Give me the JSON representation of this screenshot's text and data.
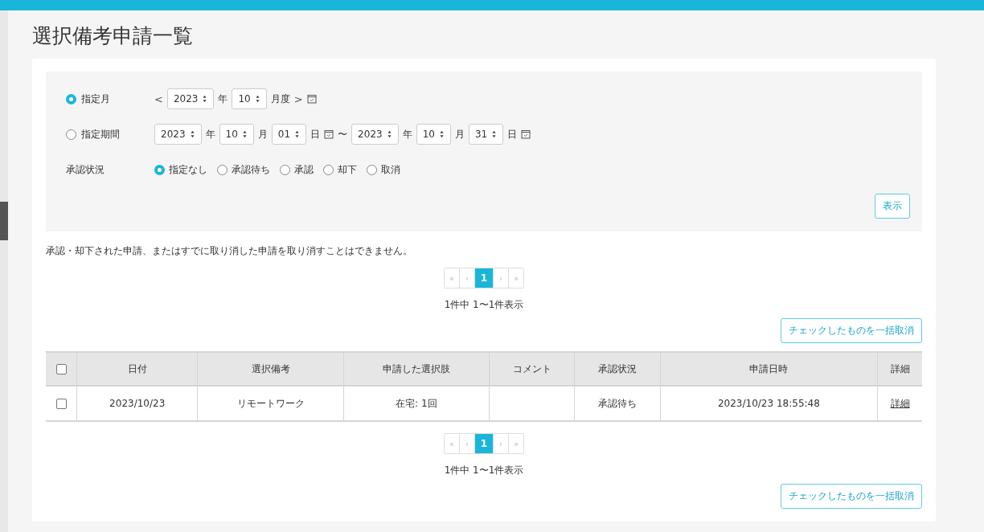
{
  "title": "選択備考申請一覧",
  "period_options": [
    {
      "label": "指定月",
      "selected": true,
      "parts": [
        {
          "kind": "prev",
          "text": "<"
        },
        {
          "kind": "select",
          "value": "2023"
        },
        {
          "kind": "unit",
          "text": "年"
        },
        {
          "kind": "select",
          "value": "10"
        },
        {
          "kind": "unit",
          "text": "月度"
        },
        {
          "kind": "next",
          "text": ">"
        },
        {
          "kind": "calendar"
        }
      ]
    },
    {
      "label": "指定期間",
      "selected": false,
      "parts": [
        {
          "kind": "select",
          "value": "2023"
        },
        {
          "kind": "unit",
          "text": "年"
        },
        {
          "kind": "select",
          "value": "10"
        },
        {
          "kind": "unit",
          "text": "月"
        },
        {
          "kind": "select",
          "value": "01"
        },
        {
          "kind": "unit",
          "text": "日"
        },
        {
          "kind": "calendar"
        },
        {
          "kind": "unit",
          "text": "〜"
        },
        {
          "kind": "select",
          "value": "2023"
        },
        {
          "kind": "unit",
          "text": "年"
        },
        {
          "kind": "select",
          "value": "10"
        },
        {
          "kind": "unit",
          "text": "月"
        },
        {
          "kind": "select",
          "value": "31"
        },
        {
          "kind": "unit",
          "text": "日"
        },
        {
          "kind": "calendar"
        }
      ]
    }
  ],
  "status_filter": {
    "label": "承認状況",
    "options": [
      {
        "label": "指定なし",
        "selected": true
      },
      {
        "label": "承認待ち",
        "selected": false
      },
      {
        "label": "承認",
        "selected": false
      },
      {
        "label": "却下",
        "selected": false
      },
      {
        "label": "取消",
        "selected": false
      }
    ]
  },
  "show_button": "表示",
  "notice": "承認・却下された申請、またはすでに取り消した申請を取り消すことはできません。",
  "pager_top": {
    "pages": [
      {
        "text": "«",
        "selected": false,
        "disabled": true
      },
      {
        "text": "‹",
        "selected": false,
        "disabled": true
      },
      {
        "text": "1",
        "selected": true,
        "disabled": false
      },
      {
        "text": "›",
        "selected": false,
        "disabled": true
      },
      {
        "text": "»",
        "selected": false,
        "disabled": true
      }
    ],
    "count": "1件中 1〜1件表示",
    "bulk_button": "チェックしたものを一括取消"
  },
  "table": {
    "select_all": {
      "checked": false
    },
    "columns": [
      "日付",
      "選択備考",
      "申請した選択肢",
      "コメント",
      "承認状況",
      "申請日時",
      "詳細"
    ],
    "rows": [
      {
        "checked": false,
        "cells": [
          "2023/10/23",
          "リモートワーク",
          "在宅: 1回",
          "",
          "承認待ち",
          "2023/10/23 18:55:48"
        ],
        "detail": "詳細"
      }
    ]
  },
  "pager_bottom": {
    "pages": [
      {
        "text": "«",
        "selected": false,
        "disabled": true
      },
      {
        "text": "‹",
        "selected": false,
        "disabled": true
      },
      {
        "text": "1",
        "selected": true,
        "disabled": false
      },
      {
        "text": "›",
        "selected": false,
        "disabled": true
      },
      {
        "text": "»",
        "selected": false,
        "disabled": true
      }
    ],
    "count": "1件中 1〜1件表示",
    "bulk_button": "チェックしたものを一括取消"
  }
}
